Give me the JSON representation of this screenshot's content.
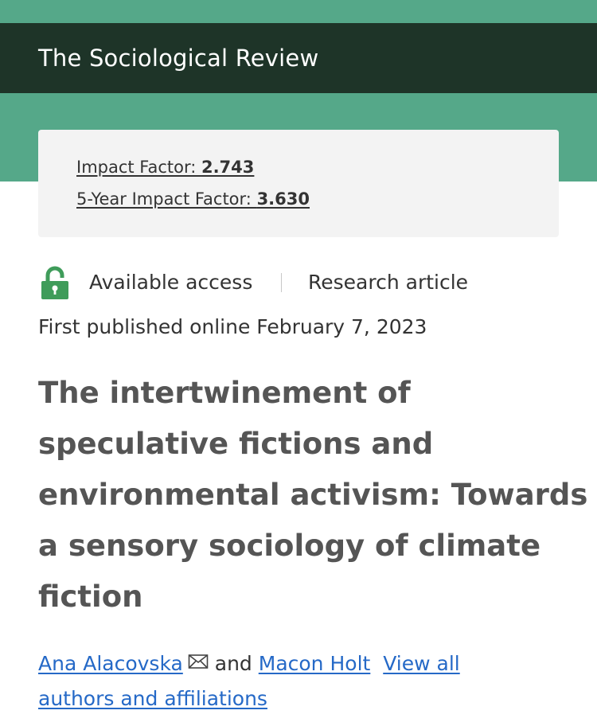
{
  "header": {
    "journal_title": "The Sociological Review"
  },
  "metrics": {
    "impact_factor_label": "Impact Factor: ",
    "impact_factor_value": "2.743",
    "five_year_label": "5-Year Impact Factor: ",
    "five_year_value": "3.630"
  },
  "meta": {
    "access_icon": "unlocked-padlock-icon",
    "access_label": "Available access",
    "article_type": "Research article",
    "published": "First published online February 7, 2023"
  },
  "article": {
    "title_lines": [
      "The intertwinement of",
      "speculative fictions and",
      "environmental activism: Towards",
      "a sensory sociology of climate",
      "fiction"
    ]
  },
  "authors": {
    "author_1": "Ana Alacovska",
    "author_1_icon": "envelope-icon",
    "conjunction": " and ",
    "author_2": "Macon Holt",
    "view_all_line1": "View all",
    "view_all_line2": "authors and affiliations"
  },
  "colors": {
    "brand_green": "#55a889",
    "header_dark": "#1e3428",
    "access_green": "#3f9c5a",
    "link_blue": "#2569c7"
  }
}
